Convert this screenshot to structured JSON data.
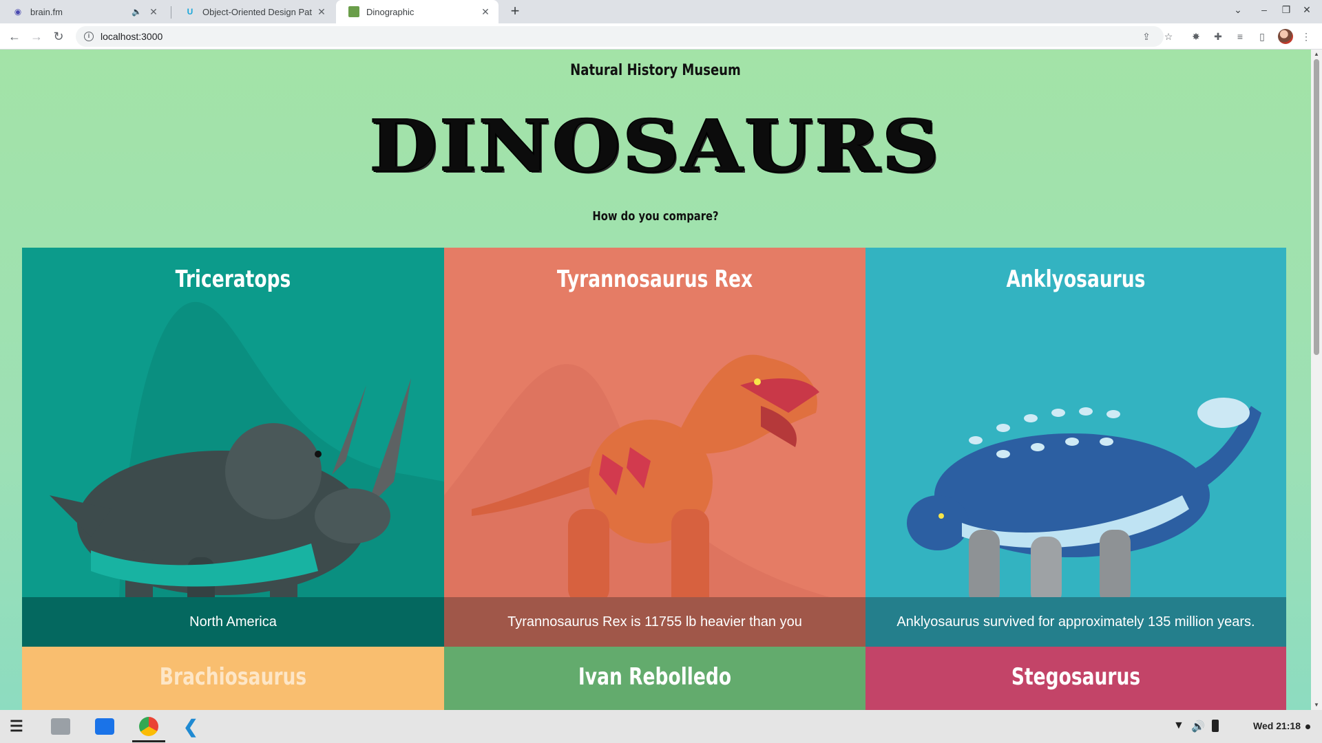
{
  "browser": {
    "tabs": [
      {
        "title": "brain.fm",
        "favicon": "brainfm-icon",
        "muted": true
      },
      {
        "title": "Object-Oriented Design Pat",
        "favicon": "udacity-icon"
      },
      {
        "title": "Dinographic",
        "favicon": "dinographic-icon",
        "active": true
      }
    ],
    "url": "localhost:3000"
  },
  "page": {
    "museum": "Natural History Museum",
    "hero": "DINOSAURS",
    "subtitle": "How do you compare?",
    "cards": [
      {
        "name": "Triceratops",
        "fact": "North America",
        "color": "#0c9b8b"
      },
      {
        "name": "Tyrannosaurus Rex",
        "fact": "Tyrannosaurus Rex is 11755 lb heavier than you",
        "color": "#e57c65"
      },
      {
        "name": "Anklyosaurus",
        "fact": "Anklyosaurus survived for approximately 135 million years.",
        "color": "#33b3c1"
      },
      {
        "name": "Brachiosaurus",
        "color": "#f9be6f"
      },
      {
        "name": "Ivan Rebolledo",
        "color": "#63ab6d"
      },
      {
        "name": "Stegosaurus",
        "color": "#c34468"
      }
    ]
  },
  "taskbar": {
    "clock": "Wed 21:18"
  }
}
